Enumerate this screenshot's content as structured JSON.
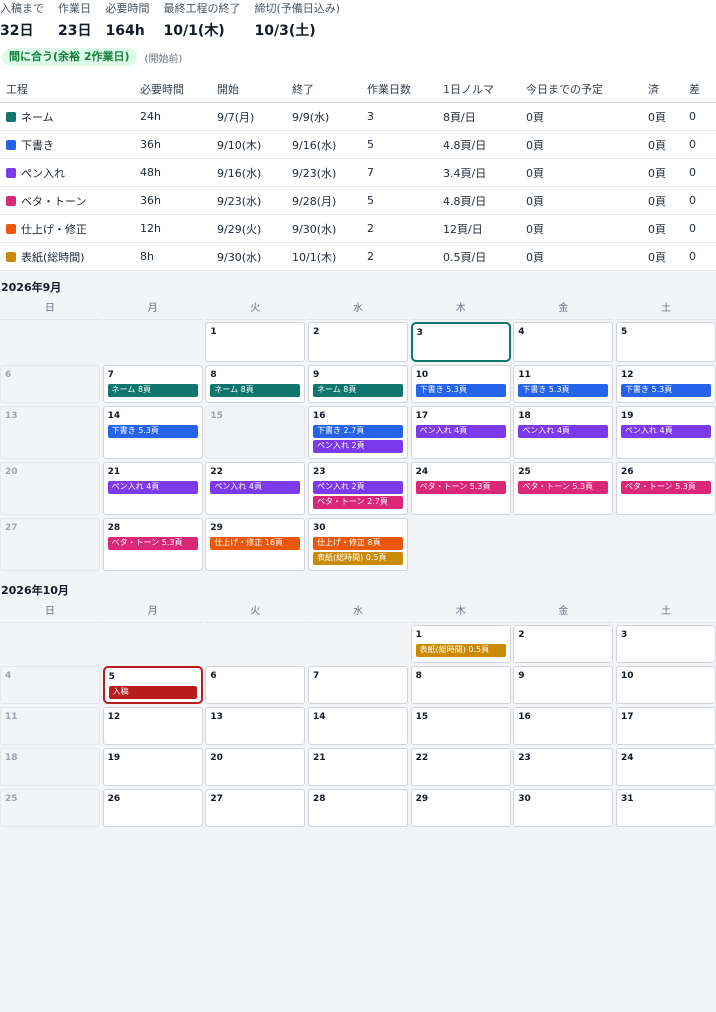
{
  "summary": {
    "stats": [
      {
        "label": "入稿まで",
        "value": "32日"
      },
      {
        "label": "作業日",
        "value": "23日"
      },
      {
        "label": "必要時間",
        "value": "164h"
      },
      {
        "label": "最終工程の終了",
        "value": "10/1(木)"
      },
      {
        "label": "締切(予備日込み)",
        "value": "10/3(土)"
      }
    ],
    "status": "間に合う(余裕 2作業日)",
    "status_note": "(開始前)"
  },
  "colors": {
    "name": "#0f766e",
    "draft": "#2563eb",
    "ink": "#7c3aed",
    "tone": "#db2777",
    "finish": "#ea580c",
    "cover": "#ca8a04",
    "submit": "#b91c1c"
  },
  "processes": {
    "headers": [
      "工程",
      "必要時間",
      "開始",
      "終了",
      "作業日数",
      "1日ノルマ",
      "今日までの予定",
      "済",
      "差"
    ],
    "rows": [
      {
        "color": "name",
        "name": "ネーム",
        "hours": "24h",
        "start": "9/7(月)",
        "end": "9/9(水)",
        "days": "3",
        "quota": "8頁/日",
        "planned": "0頁",
        "done": "0頁",
        "diff": "0"
      },
      {
        "color": "draft",
        "name": "下書き",
        "hours": "36h",
        "start": "9/10(木)",
        "end": "9/16(水)",
        "days": "5",
        "quota": "4.8頁/日",
        "planned": "0頁",
        "done": "0頁",
        "diff": "0"
      },
      {
        "color": "ink",
        "name": "ペン入れ",
        "hours": "48h",
        "start": "9/16(水)",
        "end": "9/23(水)",
        "days": "7",
        "quota": "3.4頁/日",
        "planned": "0頁",
        "done": "0頁",
        "diff": "0"
      },
      {
        "color": "tone",
        "name": "ベタ・トーン",
        "hours": "36h",
        "start": "9/23(水)",
        "end": "9/28(月)",
        "days": "5",
        "quota": "4.8頁/日",
        "planned": "0頁",
        "done": "0頁",
        "diff": "0"
      },
      {
        "color": "finish",
        "name": "仕上げ・修正",
        "hours": "12h",
        "start": "9/29(火)",
        "end": "9/30(水)",
        "days": "2",
        "quota": "12頁/日",
        "planned": "0頁",
        "done": "0頁",
        "diff": "0"
      },
      {
        "color": "cover",
        "name": "表紙(総時間)",
        "hours": "8h",
        "start": "9/30(水)",
        "end": "10/1(木)",
        "days": "2",
        "quota": "0.5頁/日",
        "planned": "0頁",
        "done": "0頁",
        "diff": "0"
      }
    ]
  },
  "weekdays": [
    "日",
    "月",
    "火",
    "水",
    "木",
    "金",
    "土"
  ],
  "calendars": [
    {
      "title": "2026年9月",
      "row_heights": [
        40,
        38,
        53,
        53,
        53
      ],
      "weeks": [
        [
          null,
          null,
          {
            "d": "1"
          },
          {
            "d": "2"
          },
          {
            "d": "3",
            "today": true
          },
          {
            "d": "4"
          },
          {
            "d": "5"
          }
        ],
        [
          {
            "d": "6",
            "off": true
          },
          {
            "d": "7",
            "tasks": [
              [
                "name",
                "ネーム 8頁"
              ]
            ]
          },
          {
            "d": "8",
            "tasks": [
              [
                "name",
                "ネーム 8頁"
              ]
            ]
          },
          {
            "d": "9",
            "tasks": [
              [
                "name",
                "ネーム 8頁"
              ]
            ]
          },
          {
            "d": "10",
            "tasks": [
              [
                "draft",
                "下書き 5.3頁"
              ]
            ]
          },
          {
            "d": "11",
            "tasks": [
              [
                "draft",
                "下書き 5.3頁"
              ]
            ]
          },
          {
            "d": "12",
            "tasks": [
              [
                "draft",
                "下書き 5.3頁"
              ]
            ]
          }
        ],
        [
          {
            "d": "13",
            "off": true
          },
          {
            "d": "14",
            "tasks": [
              [
                "draft",
                "下書き 5.3頁"
              ]
            ]
          },
          {
            "d": "15",
            "off": true
          },
          {
            "d": "16",
            "tasks": [
              [
                "draft",
                "下書き 2.7頁"
              ],
              [
                "ink",
                "ペン入れ 2頁"
              ]
            ]
          },
          {
            "d": "17",
            "tasks": [
              [
                "ink",
                "ペン入れ 4頁"
              ]
            ]
          },
          {
            "d": "18",
            "tasks": [
              [
                "ink",
                "ペン入れ 4頁"
              ]
            ]
          },
          {
            "d": "19",
            "tasks": [
              [
                "ink",
                "ペン入れ 4頁"
              ]
            ]
          }
        ],
        [
          {
            "d": "20",
            "off": true
          },
          {
            "d": "21",
            "tasks": [
              [
                "ink",
                "ペン入れ 4頁"
              ]
            ]
          },
          {
            "d": "22",
            "tasks": [
              [
                "ink",
                "ペン入れ 4頁"
              ]
            ]
          },
          {
            "d": "23",
            "tasks": [
              [
                "ink",
                "ペン入れ 2頁"
              ],
              [
                "tone",
                "ベタ・トーン 2.7頁"
              ]
            ]
          },
          {
            "d": "24",
            "tasks": [
              [
                "tone",
                "ベタ・トーン 5.3頁"
              ]
            ]
          },
          {
            "d": "25",
            "tasks": [
              [
                "tone",
                "ベタ・トーン 5.3頁"
              ]
            ]
          },
          {
            "d": "26",
            "tasks": [
              [
                "tone",
                "ベタ・トーン 5.3頁"
              ]
            ]
          }
        ],
        [
          {
            "d": "27",
            "off": true
          },
          {
            "d": "28",
            "tasks": [
              [
                "tone",
                "ベタ・トーン 5.3頁"
              ]
            ]
          },
          {
            "d": "29",
            "tasks": [
              [
                "finish",
                "仕上げ・修正 16頁"
              ]
            ]
          },
          {
            "d": "30",
            "tasks": [
              [
                "finish",
                "仕上げ・修正 8頁"
              ],
              [
                "cover",
                "表紙(総時間) 0.5頁"
              ]
            ]
          },
          null,
          null,
          null
        ]
      ]
    },
    {
      "title": "2026年10月",
      "row_heights": [
        38,
        38,
        38,
        38,
        38
      ],
      "weeks": [
        [
          null,
          null,
          null,
          null,
          {
            "d": "1",
            "tasks": [
              [
                "cover",
                "表紙(総時間) 0.5頁"
              ]
            ]
          },
          {
            "d": "2"
          },
          {
            "d": "3"
          }
        ],
        [
          {
            "d": "4",
            "off": true
          },
          {
            "d": "5",
            "deadline": true,
            "tasks": [
              [
                "submit",
                "入稿"
              ]
            ]
          },
          {
            "d": "6"
          },
          {
            "d": "7"
          },
          {
            "d": "8"
          },
          {
            "d": "9"
          },
          {
            "d": "10"
          }
        ],
        [
          {
            "d": "11",
            "off": true
          },
          {
            "d": "12"
          },
          {
            "d": "13"
          },
          {
            "d": "14"
          },
          {
            "d": "15"
          },
          {
            "d": "16"
          },
          {
            "d": "17"
          }
        ],
        [
          {
            "d": "18",
            "off": true
          },
          {
            "d": "19"
          },
          {
            "d": "20"
          },
          {
            "d": "21"
          },
          {
            "d": "22"
          },
          {
            "d": "23"
          },
          {
            "d": "24"
          }
        ],
        [
          {
            "d": "25",
            "off": true
          },
          {
            "d": "26"
          },
          {
            "d": "27"
          },
          {
            "d": "28"
          },
          {
            "d": "29"
          },
          {
            "d": "30"
          },
          {
            "d": "31"
          }
        ]
      ]
    }
  ]
}
